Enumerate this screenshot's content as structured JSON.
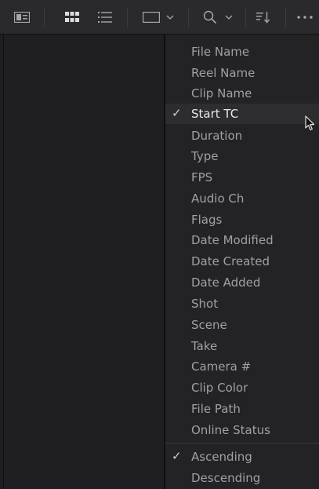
{
  "toolbar": {
    "buttons": [
      {
        "name": "metadata-view-icon"
      },
      {
        "name": "thumbnail-view-icon"
      },
      {
        "name": "list-view-icon"
      },
      {
        "name": "clip-size-icon"
      },
      {
        "name": "search-icon"
      },
      {
        "name": "sort-icon"
      },
      {
        "name": "more-options-icon"
      }
    ]
  },
  "sort_menu": {
    "fields": [
      {
        "label": "File Name",
        "checked": false
      },
      {
        "label": "Reel Name",
        "checked": false
      },
      {
        "label": "Clip Name",
        "checked": false
      },
      {
        "label": "Start TC",
        "checked": true
      },
      {
        "label": "Duration",
        "checked": false
      },
      {
        "label": "Type",
        "checked": false
      },
      {
        "label": "FPS",
        "checked": false
      },
      {
        "label": "Audio Ch",
        "checked": false
      },
      {
        "label": "Flags",
        "checked": false
      },
      {
        "label": "Date Modified",
        "checked": false
      },
      {
        "label": "Date Created",
        "checked": false
      },
      {
        "label": "Date Added",
        "checked": false
      },
      {
        "label": "Shot",
        "checked": false
      },
      {
        "label": "Scene",
        "checked": false
      },
      {
        "label": "Take",
        "checked": false
      },
      {
        "label": "Camera #",
        "checked": false
      },
      {
        "label": "Clip Color",
        "checked": false
      },
      {
        "label": "File Path",
        "checked": false
      },
      {
        "label": "Online Status",
        "checked": false
      }
    ],
    "order": [
      {
        "label": "Ascending",
        "checked": true
      },
      {
        "label": "Descending",
        "checked": false
      }
    ],
    "check_glyph": "✓"
  }
}
